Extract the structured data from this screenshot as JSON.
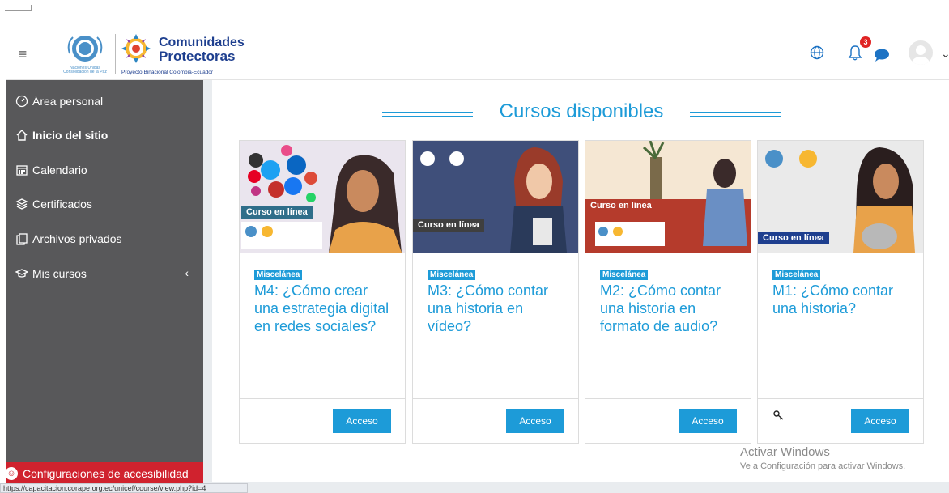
{
  "navbar": {
    "un_org": "Naciones Unidas",
    "un_org_sub": "Consolidación de la Paz",
    "brand_line1": "Comunidades",
    "brand_line2": "Protectoras",
    "brand_sub": "Proyecto Binacional Colombia-Ecuador",
    "notification_count": "3"
  },
  "sidebar": {
    "items": [
      {
        "label": "Área personal",
        "icon": "gauge-icon"
      },
      {
        "label": "Inicio del sitio",
        "icon": "home-icon"
      },
      {
        "label": "Calendario",
        "icon": "calendar-icon"
      },
      {
        "label": "Certificados",
        "icon": "layers-icon"
      },
      {
        "label": "Archivos privados",
        "icon": "files-icon"
      },
      {
        "label": "Mis cursos",
        "icon": "graduation-cap-icon"
      }
    ],
    "accessibility": "Configuraciones de accesibilidad"
  },
  "main": {
    "section_title": "Cursos disponibles",
    "courses": [
      {
        "category": "Miscelánea",
        "title": "M4: ¿Cómo crear una estrategia digital en redes sociales?",
        "button": "Acceso",
        "tag": "Curso en línea"
      },
      {
        "category": "Miscelánea",
        "title": "M3: ¿Cómo contar una historia en vídeo?",
        "button": "Acceso",
        "tag": "Curso en línea"
      },
      {
        "category": "Miscelánea",
        "title": "M2: ¿Cómo contar una historia en formato de audio?",
        "button": "Acceso",
        "tag": "Curso en línea"
      },
      {
        "category": "Miscelánea",
        "title": "M1: ¿Cómo contar una historia?",
        "button": "Acceso",
        "tag": "Curso en línea"
      }
    ],
    "img_brand": "Comunidades Protectoras"
  },
  "status_url": "https://capacitacion.corape.org.ec/unicef/course/view.php?id=4",
  "watermark": {
    "line1": "Activar Windows",
    "line2": "Ve a Configuración para activar Windows."
  },
  "colors": {
    "accent": "#1d9bd8",
    "sidebar": "#58585a",
    "alert": "#d0222e"
  }
}
